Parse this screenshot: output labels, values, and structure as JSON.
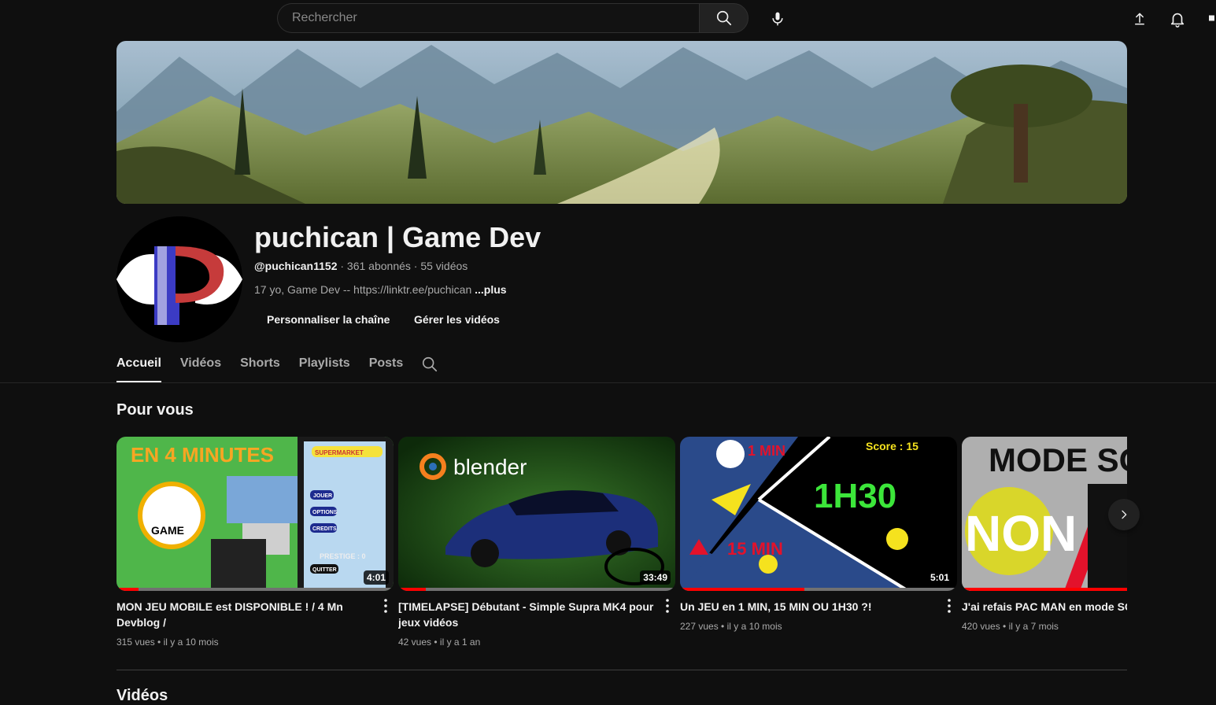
{
  "search": {
    "placeholder": "Rechercher"
  },
  "channel": {
    "name": "puchican | Game Dev",
    "handle": "@puchican1152",
    "stats": " · 361 abonnés · 55 vidéos",
    "description": "17 yo, Game Dev -- https://linktr.ee/puchican ",
    "more": "...plus",
    "customize_label": "Personnaliser la chaîne",
    "manage_label": "Gérer les vidéos"
  },
  "tabs": [
    "Accueil",
    "Vidéos",
    "Shorts",
    "Playlists",
    "Posts"
  ],
  "section": {
    "title": "Pour vous",
    "next_title": "Vidéos"
  },
  "videos": [
    {
      "title": "MON JEU MOBILE est DISPONIBLE ! / 4 Mn Devblog /",
      "views": "315 vues",
      "age": "il y a 10 mois",
      "duration": "4:01",
      "watched": 0.08,
      "thumb_text": "EN 4 MINUTES"
    },
    {
      "title": "[TIMELAPSE] Débutant - Simple Supra MK4 pour jeux vidéos",
      "views": "42 vues",
      "age": "il y a 1 an",
      "duration": "33:49",
      "watched": 0.1,
      "thumb_text": "blender"
    },
    {
      "title": "Un JEU en 1 MIN, 15 MIN OU 1H30 ?!",
      "views": "227 vues",
      "age": "il y a 10 mois",
      "duration": "5:01",
      "watched": 0.45,
      "thumb_text": "1H30"
    },
    {
      "title": "J'ai refais PAC MAN en mode SON",
      "views": "420 vues",
      "age": "il y a 7 mois",
      "duration": "",
      "watched": 1.0,
      "thumb_text": "MODE SO"
    }
  ],
  "thumb_labels": {
    "v1": {
      "game": "GAME",
      "market": "SUPERMARKET",
      "menu": [
        "JOUER",
        "OPTIONS",
        "CREDITS",
        "PRESTIGE : 0",
        "QUITTER"
      ]
    },
    "v3": {
      "one_min": "1 MIN",
      "fifteen_min": "15 MIN",
      "score": "Score : 15"
    },
    "v4": {
      "non": "NON"
    }
  },
  "colors": {
    "background": "#0f0f0f",
    "accent_red": "#ff0000",
    "text_primary": "#f1f1f1",
    "text_secondary": "#aaaaaa"
  },
  "icons": [
    "search-icon",
    "microphone-icon",
    "upload-icon",
    "bell-icon",
    "chevron-right-icon",
    "more-vert-icon"
  ]
}
